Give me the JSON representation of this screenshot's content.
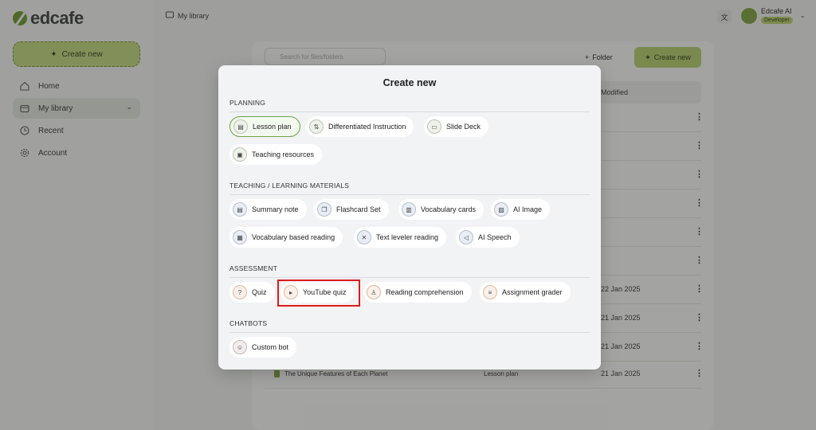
{
  "app": {
    "logo_text": "edcafe"
  },
  "sidebar": {
    "create_label": "Create new",
    "items": [
      {
        "label": "Home",
        "icon": "home-icon"
      },
      {
        "label": "My library",
        "icon": "library-icon"
      },
      {
        "label": "Recent",
        "icon": "clock-icon"
      },
      {
        "label": "Account",
        "icon": "gear-icon"
      }
    ]
  },
  "topbar": {
    "breadcrumb": "My library",
    "user_name": "Edcafe AI",
    "user_badge": "Developer"
  },
  "library": {
    "search_placeholder": "Search for files/folders",
    "folder_label": "Folder",
    "create_label": "Create new",
    "modified_header": "Modified",
    "rows": [
      {
        "title": "",
        "type": "",
        "date": ""
      },
      {
        "title": "",
        "type": "",
        "date": ""
      },
      {
        "title": "",
        "type": "",
        "date": ""
      },
      {
        "title": "",
        "type": "",
        "date": ""
      },
      {
        "title": "",
        "type": "",
        "date": ""
      },
      {
        "title": "",
        "type": "",
        "date": ""
      },
      {
        "title": "",
        "type": "",
        "date": "22 Jan 2025"
      },
      {
        "title": "",
        "type": "",
        "date": "21 Jan 2025"
      },
      {
        "title": "",
        "type": "",
        "date": "21 Jan 2025"
      },
      {
        "title": "The Unique Features of Each Planet",
        "type": "Lesson plan",
        "date": "21 Jan 2025"
      }
    ]
  },
  "modal": {
    "title": "Create new",
    "sections": [
      {
        "label": "PLANNING",
        "items": [
          {
            "label": "Lesson plan",
            "icon": "document-icon"
          },
          {
            "label": "Differentiated Instruction",
            "icon": "branch-icon"
          },
          {
            "label": "Slide Deck",
            "icon": "presentation-icon"
          },
          {
            "label": "Teaching resources",
            "icon": "box-icon"
          }
        ]
      },
      {
        "label": "TEACHING / LEARNING MATERIALS",
        "items": [
          {
            "label": "Summary note",
            "icon": "note-icon"
          },
          {
            "label": "Flashcard Set",
            "icon": "cards-icon"
          },
          {
            "label": "Vocabulary cards",
            "icon": "vocab-icon"
          },
          {
            "label": "AI Image",
            "icon": "image-icon"
          },
          {
            "label": "Vocabulary based reading",
            "icon": "book-icon"
          },
          {
            "label": "Text leveler reading",
            "icon": "scissors-icon"
          },
          {
            "label": "AI Speech",
            "icon": "speaker-icon"
          }
        ]
      },
      {
        "label": "ASSESSMENT",
        "items": [
          {
            "label": "Quiz",
            "icon": "quiz-icon"
          },
          {
            "label": "YouTube quiz",
            "icon": "play-icon"
          },
          {
            "label": "Reading comprehension",
            "icon": "reader-icon"
          },
          {
            "label": "Assignment grader",
            "icon": "checklist-icon"
          }
        ]
      },
      {
        "label": "CHATBOTS",
        "items": [
          {
            "label": "Custom bot",
            "icon": "bot-icon"
          }
        ]
      }
    ]
  },
  "colors": {
    "accent": "#b6cf6a",
    "selected_border": "#6ca24a",
    "highlight": "#e11a1a"
  }
}
